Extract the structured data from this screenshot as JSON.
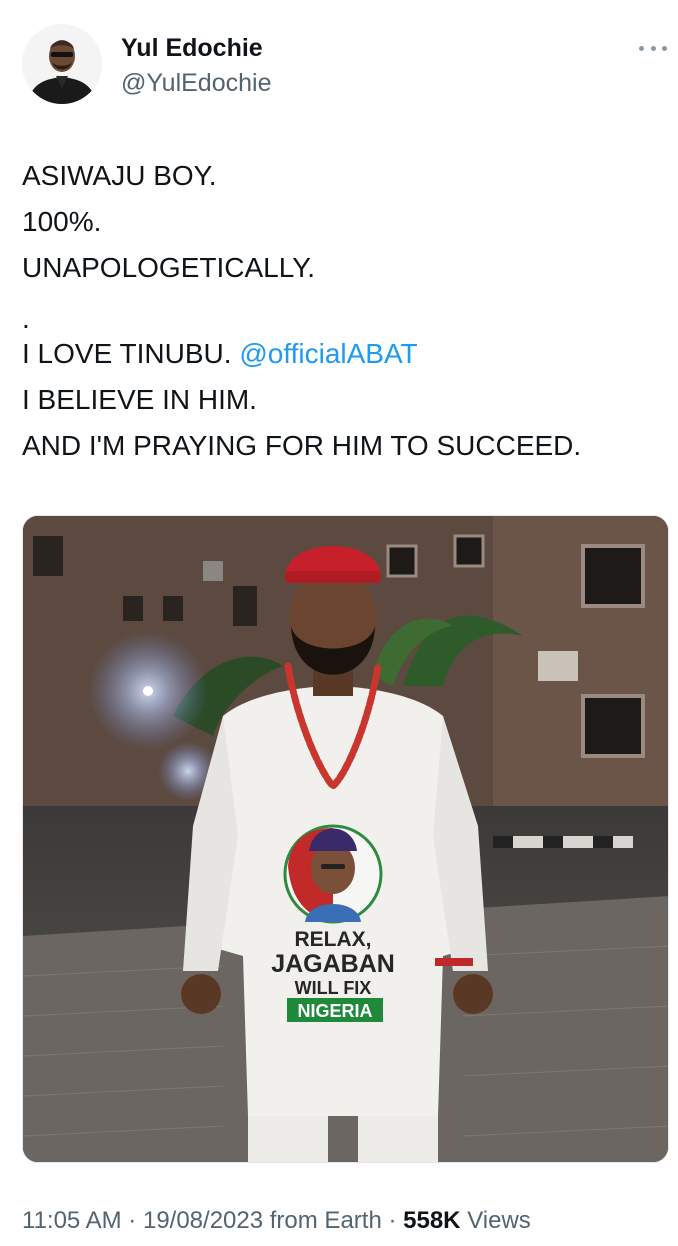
{
  "author": {
    "display_name": "Yul Edochie",
    "handle": "@YulEdochie",
    "avatar_icon": "avatar-photo"
  },
  "tweet": {
    "lines": [
      "ASIWAJU BOY.",
      "100%.",
      "UNAPOLOGETICALLY.",
      ".",
      "I LOVE TINUBU.",
      "I BELIEVE IN HIM.",
      "AND I'M PRAYING FOR HIM TO SUCCEED."
    ],
    "mention": "@officialABAT"
  },
  "photo_text": {
    "line1": "RELAX,",
    "line2": "JAGABAN",
    "line3": "WILL FIX",
    "line4": "NIGERIA"
  },
  "meta": {
    "time": "11:05 AM",
    "date": "19/08/2023",
    "source": "from Earth",
    "views_count": "558K",
    "views_label": "Views",
    "separator": "·"
  },
  "colors": {
    "link": "#1d9bf0",
    "secondary_text": "#536471",
    "primary_text": "#0f1419",
    "nigeria_green": "#1f8a3a"
  },
  "icons": {
    "more": "more-horizontal-icon"
  }
}
